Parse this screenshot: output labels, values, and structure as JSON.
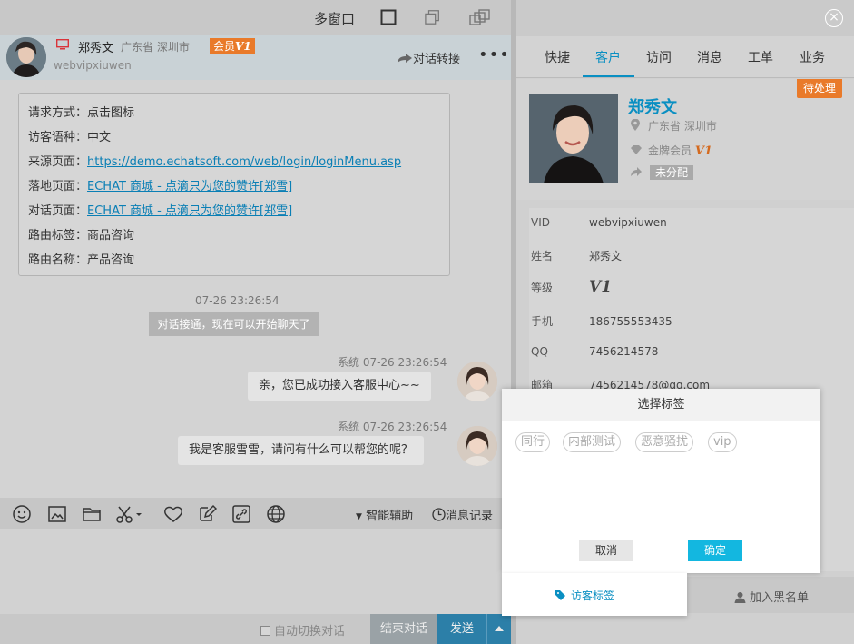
{
  "titlebar": {
    "multi_window": "多窗口"
  },
  "header": {
    "name": "郑秀文",
    "location": "广东省 深圳市",
    "member_prefix": "会员",
    "member_level": "V1",
    "visitor_id": "webvipxiuwen",
    "transfer": "对话转接",
    "more": "•••"
  },
  "info_card": {
    "rows": [
      {
        "label": "请求方式：",
        "value": "点击图标"
      },
      {
        "label": "访客语种：",
        "value": "中文"
      },
      {
        "label": "来源页面：",
        "value": "https://demo.echatsoft.com/web/login/loginMenu.asp"
      },
      {
        "label": "落地页面：",
        "value": "ECHAT 商城 - 点滴只为您的赞许[郑雪]"
      },
      {
        "label": "对话页面：",
        "value": "ECHAT 商城 - 点滴只为您的赞许[郑雪]"
      },
      {
        "label": "路由标签：",
        "value": "商品咨询"
      },
      {
        "label": "路由名称：",
        "value": "产品咨询"
      }
    ]
  },
  "messages": {
    "connect_time": "07-26 23:26:54",
    "connect_note": "对话接通，现在可以开始聊天了",
    "m1_meta": "系统  07-26 23:26:54",
    "m1_text": "亲，您已成功接入客服中心~~",
    "m2_meta": "系统  07-26 23:26:54",
    "m2_text": "我是客服雪雪，请问有什么可以帮您的呢？"
  },
  "toolbar": {
    "assist": "智能辅助",
    "history": "消息记录"
  },
  "bottom": {
    "auto_switch": "自动切换对话",
    "end": "结束对话",
    "send": "发送"
  },
  "right": {
    "tabs": [
      "快捷",
      "客户",
      "访问",
      "消息",
      "工单",
      "业务"
    ],
    "active_tab": 1,
    "pending": "待处理",
    "profile": {
      "name": "郑秀文",
      "location": "广东省 深圳市",
      "member": "金牌会员",
      "level": "V1",
      "assign": "未分配"
    },
    "details": [
      {
        "key": "VID",
        "value": "webvipxiuwen"
      },
      {
        "key": "姓名",
        "value": "郑秀文"
      },
      {
        "key": "等级",
        "value": "V1"
      },
      {
        "key": "手机",
        "value": "186755553435"
      },
      {
        "key": "QQ",
        "value": "7456214578"
      },
      {
        "key": "邮箱",
        "value": "7456214578@qq.com"
      }
    ],
    "blacklist": "加入黑名单"
  },
  "modal": {
    "title": "选择标签",
    "tags": [
      "同行",
      "内部测试",
      "恶意骚扰",
      "vip"
    ],
    "cancel": "取消",
    "ok": "确定"
  },
  "visitor_tag": {
    "label": "访客标签"
  },
  "colors": {
    "accent": "#0a8fc2",
    "vip_orange": "#e97a2a",
    "confirm": "#13b7e0"
  }
}
